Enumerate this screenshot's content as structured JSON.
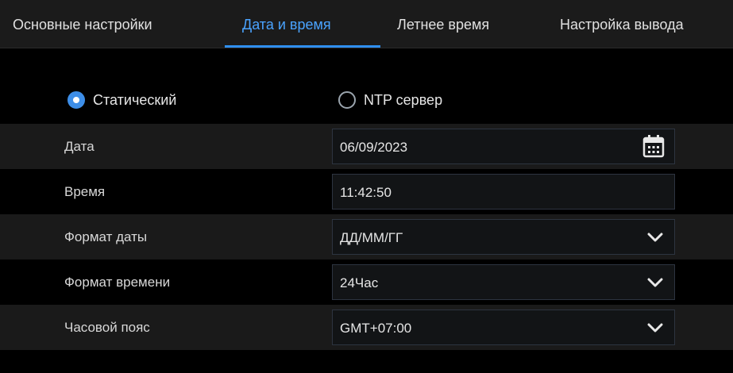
{
  "tabs": [
    {
      "label": "Основные настройки"
    },
    {
      "label": "Дата и время"
    },
    {
      "label": "Летнее время"
    },
    {
      "label": "Настройка вывода"
    }
  ],
  "active_tab_index": 1,
  "mode": {
    "static_label": "Статический",
    "ntp_label": "NTP сервер",
    "selected": "static"
  },
  "fields": {
    "date": {
      "label": "Дата",
      "value": "06/09/2023",
      "icon": "calendar-icon"
    },
    "time": {
      "label": "Время",
      "value": "11:42:50"
    },
    "date_format": {
      "label": "Формат даты",
      "value": "ДД/ММ/ГГ",
      "icon": "chevron-down-icon"
    },
    "time_format": {
      "label": "Формат времени",
      "value": "24Час",
      "icon": "chevron-down-icon"
    },
    "timezone": {
      "label": "Часовой пояс",
      "value": "GMT+07:00",
      "icon": "chevron-down-icon"
    }
  },
  "colors": {
    "accent": "#3d8ee8",
    "active_tab_text": "#4aa3ff",
    "background": "#000000",
    "row_shade": "#1a1a1a"
  }
}
